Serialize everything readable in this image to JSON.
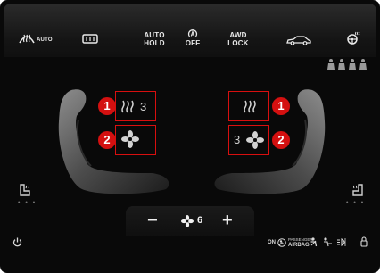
{
  "topbar": {
    "rear_defrost_label": "AUTO",
    "auto_hold_label": [
      "AUTO",
      "HOLD"
    ],
    "a_off_label": "OFF",
    "awd_lock_label": [
      "AWD",
      "LOCK"
    ]
  },
  "left_seat": {
    "heat_level": "3",
    "callout_heat": "1",
    "callout_vent": "2"
  },
  "right_seat": {
    "vent_level": "3",
    "callout_heat": "1",
    "callout_vent": "2"
  },
  "fan": {
    "minus": "−",
    "plus": "+",
    "level": "6"
  },
  "bottom": {
    "passenger_label": "PASSENGER",
    "airbag_label": "AIRBAG",
    "on_label": "ON"
  },
  "colors": {
    "callout": "#d80f0f",
    "background": "#090909"
  }
}
